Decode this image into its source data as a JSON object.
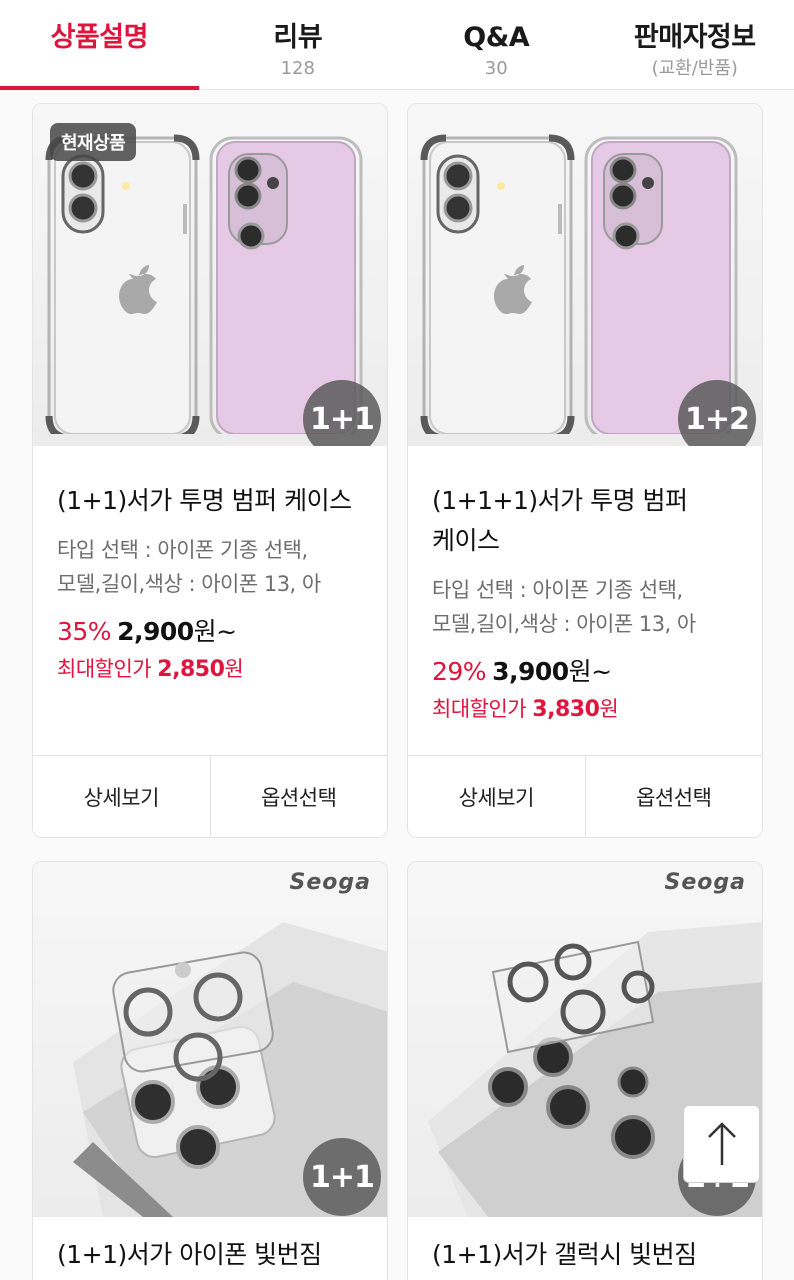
{
  "tabs": [
    {
      "label": "상품설명",
      "sub": ""
    },
    {
      "label": "리뷰",
      "sub": "128"
    },
    {
      "label": "Q&A",
      "sub": "30"
    },
    {
      "label": "판매자정보",
      "sub": "(교환/반품)"
    }
  ],
  "products": [
    {
      "badge": "현재상품",
      "bundle": "1+1",
      "title": "(1+1)서가 투명 범퍼 케이스",
      "options": "타입 선택 : 아이폰 기종 선택, 모델,길이,색상 : 아이폰 13, 아",
      "options_line1": "타입 선택 : 아이폰 기종 선택,",
      "options_line2": "모델,길이,색상 : 아이폰 13, 아",
      "discount": "35%",
      "price": "2,900",
      "price_unit": "원~",
      "max_label": "최대할인가",
      "max_price": "2,850",
      "max_unit": "원",
      "detail_button": "상세보기",
      "option_button": "옵션선택"
    },
    {
      "bundle": "1+2",
      "title": "(1+1+1)서가 투명 범퍼 케이스",
      "options_line1": "타입 선택 : 아이폰 기종 선택,",
      "options_line2": "모델,길이,색상 : 아이폰 13, 아",
      "discount": "29%",
      "price": "3,900",
      "price_unit": "원~",
      "max_label": "최대할인가",
      "max_price": "3,830",
      "max_unit": "원",
      "detail_button": "상세보기",
      "option_button": "옵션선택"
    },
    {
      "brand": "Seoga",
      "bundle": "1+1",
      "title": "(1+1)서가 아이폰 빛번짐"
    },
    {
      "brand": "Seoga",
      "bundle": "1+1",
      "title": "(1+1)서가 갤럭시 빛번짐"
    }
  ],
  "scroll_top_icon": "arrow-up-icon",
  "colors": {
    "accent": "#e0143c",
    "case_pink": "#e6c9e4"
  }
}
